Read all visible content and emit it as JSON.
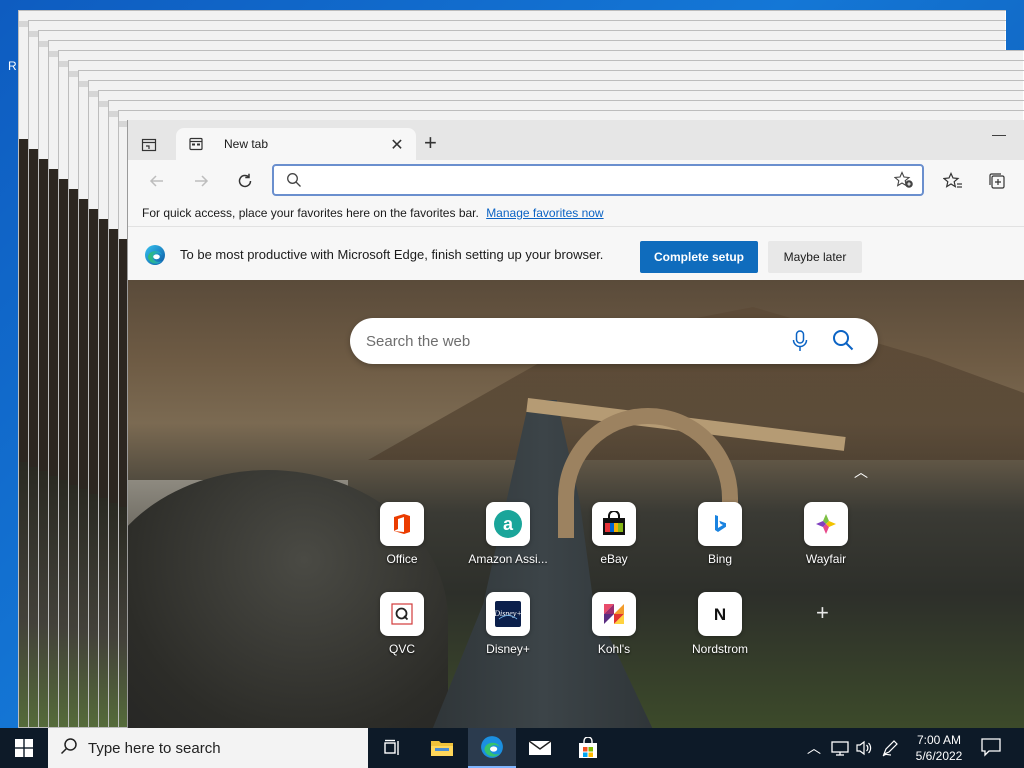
{
  "desktop": {
    "edge_label": "R"
  },
  "browser": {
    "tab": {
      "title": "New tab"
    },
    "address": {
      "placeholder": "",
      "value": ""
    },
    "favorites_bar": {
      "message": "For quick access, place your favorites here on the favorites bar.",
      "manage_link": "Manage favorites now"
    },
    "setup_banner": {
      "message": "To be most productive with Microsoft Edge, finish setting up your browser.",
      "primary_label": "Complete setup",
      "secondary_label": "Maybe later"
    }
  },
  "new_tab_page": {
    "search_placeholder": "Search the web",
    "tiles": [
      {
        "label": "Office",
        "icon": "office-icon"
      },
      {
        "label": "Amazon Assi...",
        "icon": "amazon-icon"
      },
      {
        "label": "eBay",
        "icon": "ebay-icon"
      },
      {
        "label": "Bing",
        "icon": "bing-icon"
      },
      {
        "label": "Wayfair",
        "icon": "wayfair-icon"
      },
      {
        "label": "QVC",
        "icon": "qvc-icon"
      },
      {
        "label": "Disney+",
        "icon": "disney-icon"
      },
      {
        "label": "Kohl's",
        "icon": "kohls-icon"
      },
      {
        "label": "Nordstrom",
        "icon": "nordstrom-icon"
      }
    ]
  },
  "taskbar": {
    "search_placeholder": "Type here to search",
    "clock": {
      "time": "7:00 AM",
      "date": "5/6/2022"
    }
  },
  "colors": {
    "accent": "#0f6cbd",
    "taskbar": "#0d1a28",
    "link": "#0b63c4"
  }
}
